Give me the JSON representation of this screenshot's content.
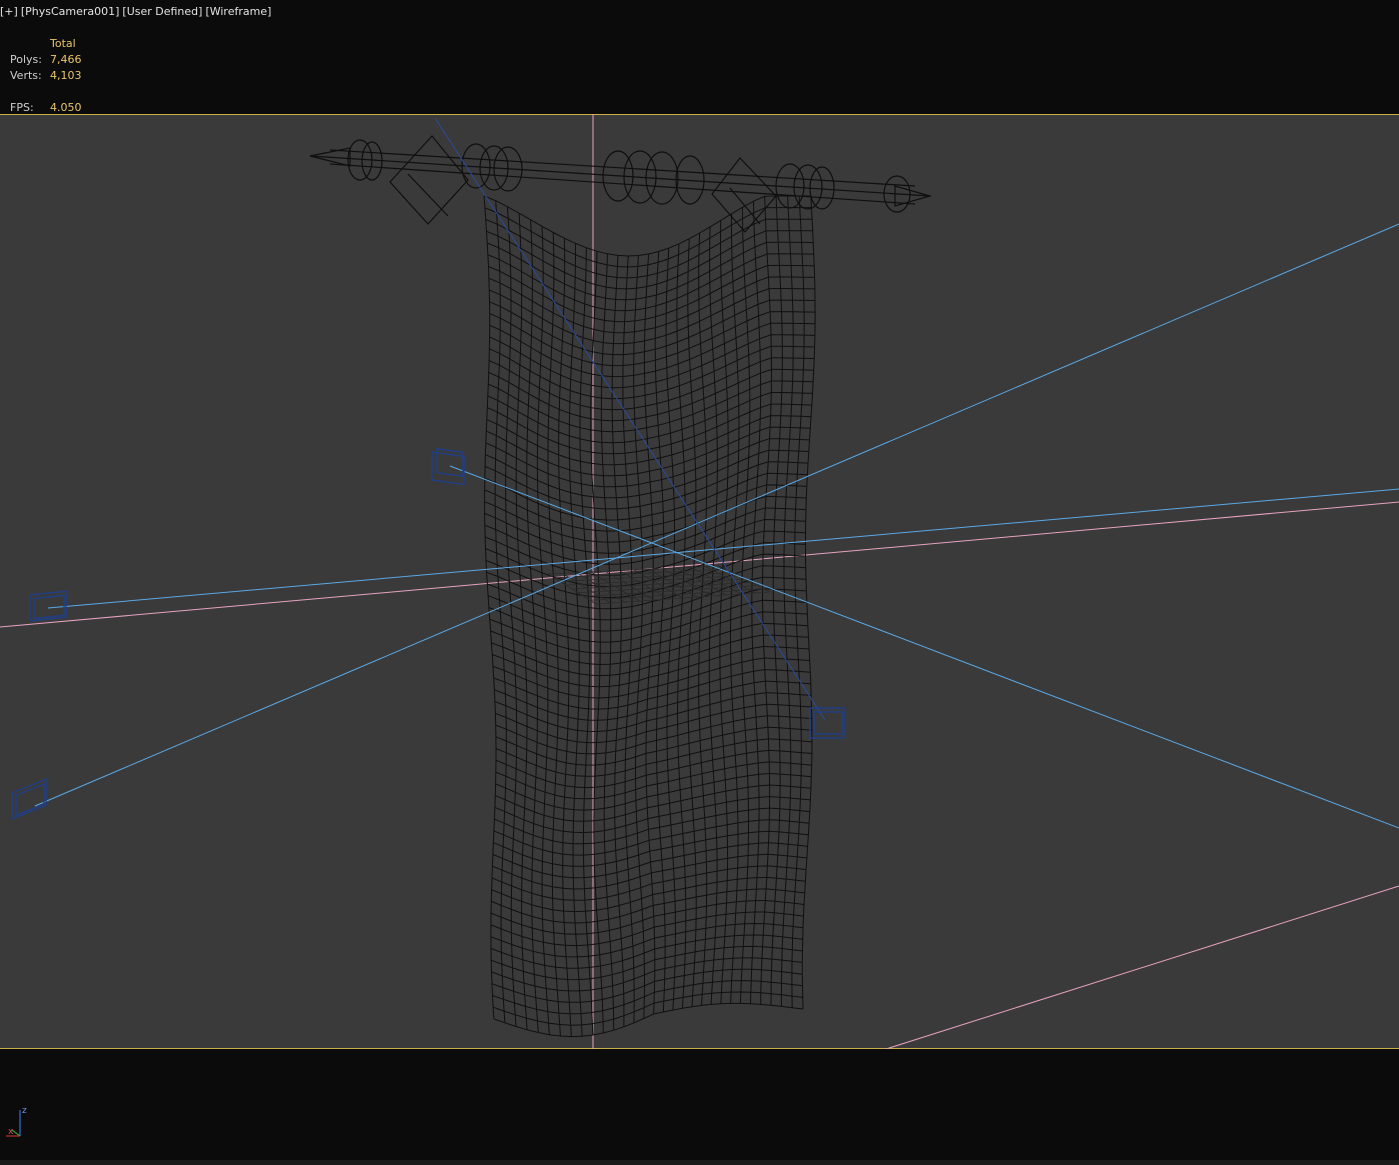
{
  "viewport": {
    "labels": [
      "[+]",
      "[PhysCamera001]",
      "[User Defined]",
      "[Wireframe]"
    ]
  },
  "stats": {
    "header": "Total",
    "polys_label": "Polys:",
    "polys_value": "7,466",
    "verts_label": "Verts:",
    "verts_value": "4,103",
    "fps_label": "FPS:",
    "fps_value": "4.050"
  },
  "gizmo": {
    "x_label": "x",
    "z_label": "z"
  },
  "colors": {
    "viewport_bg": "#3a3a3a",
    "frame_border": "#c9b24a",
    "stat_value": "#e8c56a",
    "wire": "#0e0e0e",
    "light_line": "#5aa9e6",
    "axis_pink": "#e8a3c0",
    "camera_line": "#2a4a9a"
  },
  "icons": [
    "physical-camera-icon",
    "light-target-icon",
    "axis-gizmo-icon"
  ]
}
